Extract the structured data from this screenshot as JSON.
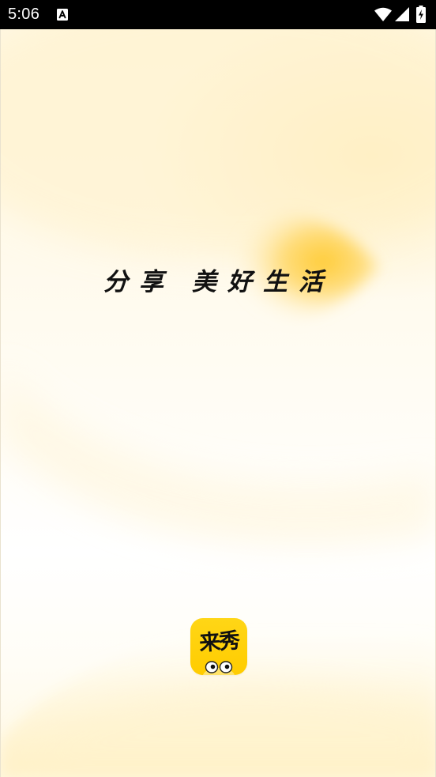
{
  "status_bar": {
    "time": "5:06",
    "notification_icon": "a-icon",
    "wifi_icon": "wifi-icon",
    "signal_icon": "signal-icon",
    "battery_icon": "battery-charging-icon"
  },
  "splash": {
    "tagline_part1": "分享",
    "tagline_part2": "美好生活",
    "logo_text": "来秀",
    "logo_icon": "app-logo-icon",
    "colors": {
      "brand_yellow": "#ffd616",
      "text": "#111111",
      "background": "#fff8e4"
    }
  }
}
